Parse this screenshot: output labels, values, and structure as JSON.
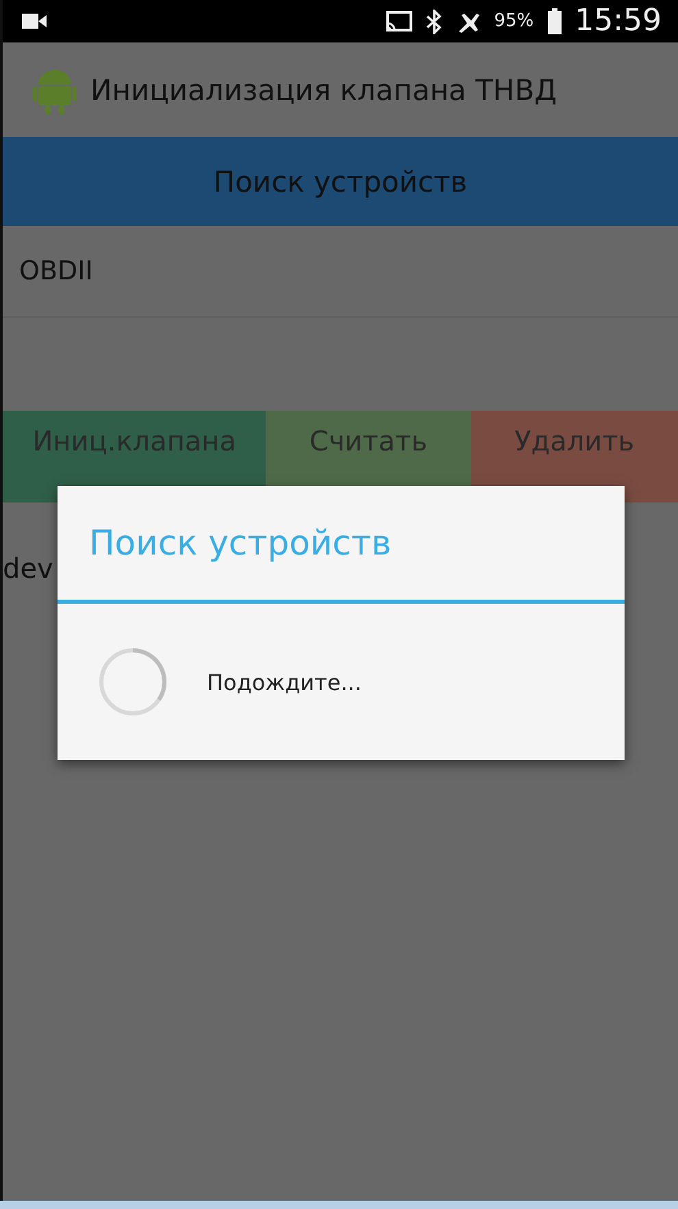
{
  "status_bar": {
    "battery": "95%",
    "time": "15:59"
  },
  "action_bar": {
    "title": "Инициализация клапана ТНВД"
  },
  "search_button": {
    "label": "Поиск устройств"
  },
  "devices": [
    "OBDII"
  ],
  "actions": [
    {
      "label": "Иниц.клапана",
      "kind": "init"
    },
    {
      "label": "Считать",
      "kind": "read"
    },
    {
      "label": "Удалить",
      "kind": "clear"
    }
  ],
  "log_text": "dev",
  "dialog": {
    "title": "Поиск устройств",
    "message": "Подождите..."
  }
}
